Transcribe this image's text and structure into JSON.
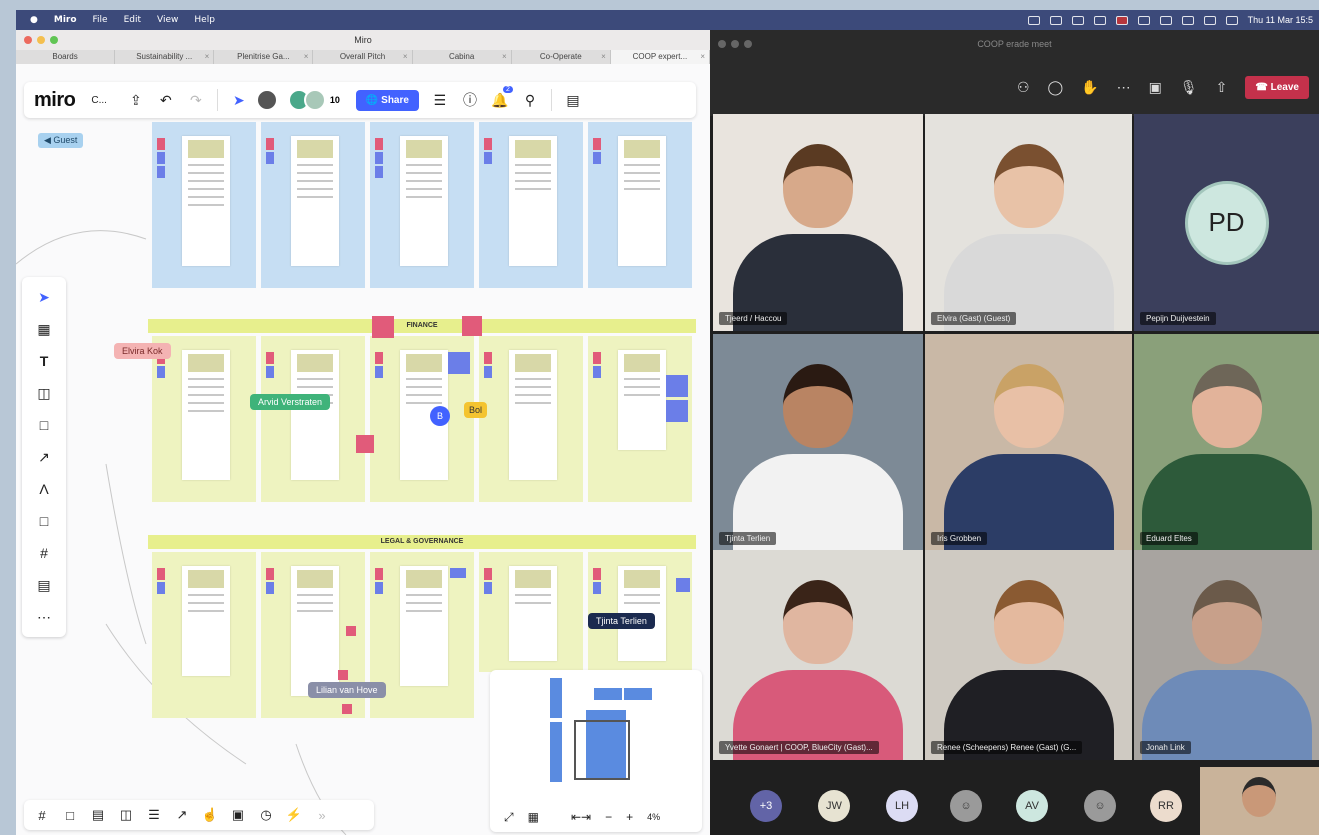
{
  "menubar": {
    "app": "Miro",
    "items": [
      "File",
      "Edit",
      "View",
      "Help"
    ],
    "clock": "Thu 11 Mar 15:5"
  },
  "miro": {
    "window_title": "Miro",
    "tabs": [
      {
        "label": "Boards"
      },
      {
        "label": "Sustainability ..."
      },
      {
        "label": "Plenitrise Ga..."
      },
      {
        "label": "Overall Pitch"
      },
      {
        "label": "Cabina"
      },
      {
        "label": "Co-Operate"
      },
      {
        "label": "COOP expert..."
      }
    ],
    "toolbar": {
      "logo": "miro",
      "board_name": "C...",
      "collaborator_count": "10",
      "share_label": "Share",
      "notification_badge": "2"
    },
    "guest_tag": "Guest",
    "bands": {
      "finance": "FINANCE",
      "legal": "LEGAL & GOVERNANCE"
    },
    "cursors": [
      {
        "name": "Elvira Kok",
        "color": "#f4b3b3"
      },
      {
        "name": "Arvid Verstraten",
        "color": "#3fb37a"
      },
      {
        "name": "Bol",
        "color": "#f4c430"
      },
      {
        "name": "Tjinta Terlien",
        "color": "#1b2a4f"
      },
      {
        "name": "Lilian van Hove",
        "color": "#8a8fa8"
      }
    ],
    "cursor_initial": "B",
    "minimap": {
      "zoom": "4%",
      "minus": "−",
      "plus": "+"
    }
  },
  "teams": {
    "window_title": "COOP erade meet",
    "leave_label": "Leave",
    "participants": [
      {
        "name": "Tjeerd / Haccou",
        "skin": "#d7a98a",
        "hair": "#5a3a22",
        "shirt": "#2a2f3a",
        "bg": "#e9e4de"
      },
      {
        "name": "Elvira (Gast) (Guest)",
        "skin": "#e8c2a7",
        "hair": "#7a5030",
        "shirt": "#d9d9d9",
        "bg": "#e4e2dd"
      },
      {
        "name": "Pepijn Duijvestein",
        "initials": "PD"
      },
      {
        "name": "Tjinta Terlien",
        "skin": "#b98463",
        "hair": "#2a1a12",
        "shirt": "#f2f2f2",
        "bg": "#7d8a96"
      },
      {
        "name": "Iris Grobben",
        "skin": "#e8c0a6",
        "hair": "#c9a266",
        "shirt": "#2c3d66",
        "bg": "#c9b8a6"
      },
      {
        "name": "Eduard Eltes",
        "skin": "#e2b39a",
        "hair": "#6e6658",
        "shirt": "#2d5a3a",
        "bg": "#8aa07a"
      },
      {
        "name": "Yvette Gonaert | COOP, BlueCity (Gast)...",
        "skin": "#e0b6a0",
        "hair": "#3a2418",
        "shirt": "#d85a7a",
        "bg": "#dcdad4"
      },
      {
        "name": "Renee (Scheepens) Renee (Gast) (G...",
        "skin": "#e4b99e",
        "hair": "#8a5a32",
        "shirt": "#1f1f24",
        "bg": "#cfcac2"
      },
      {
        "name": "Jonah Link",
        "skin": "#c8a08a",
        "hair": "#6b5a4a",
        "shirt": "#6e8bb8",
        "bg": "#a8a4a0"
      }
    ],
    "roster": [
      {
        "label": "+3",
        "color": "#6264a7"
      },
      {
        "label": "JW",
        "color": "#e7e3d2"
      },
      {
        "label": "LH",
        "color": "#dcdcf4"
      },
      {
        "label": "",
        "color": "#9a9a9a"
      },
      {
        "label": "AV",
        "color": "#cde7df"
      },
      {
        "label": "",
        "color": "#9a9a9a"
      },
      {
        "label": "RR",
        "color": "#ecdccd"
      }
    ]
  }
}
